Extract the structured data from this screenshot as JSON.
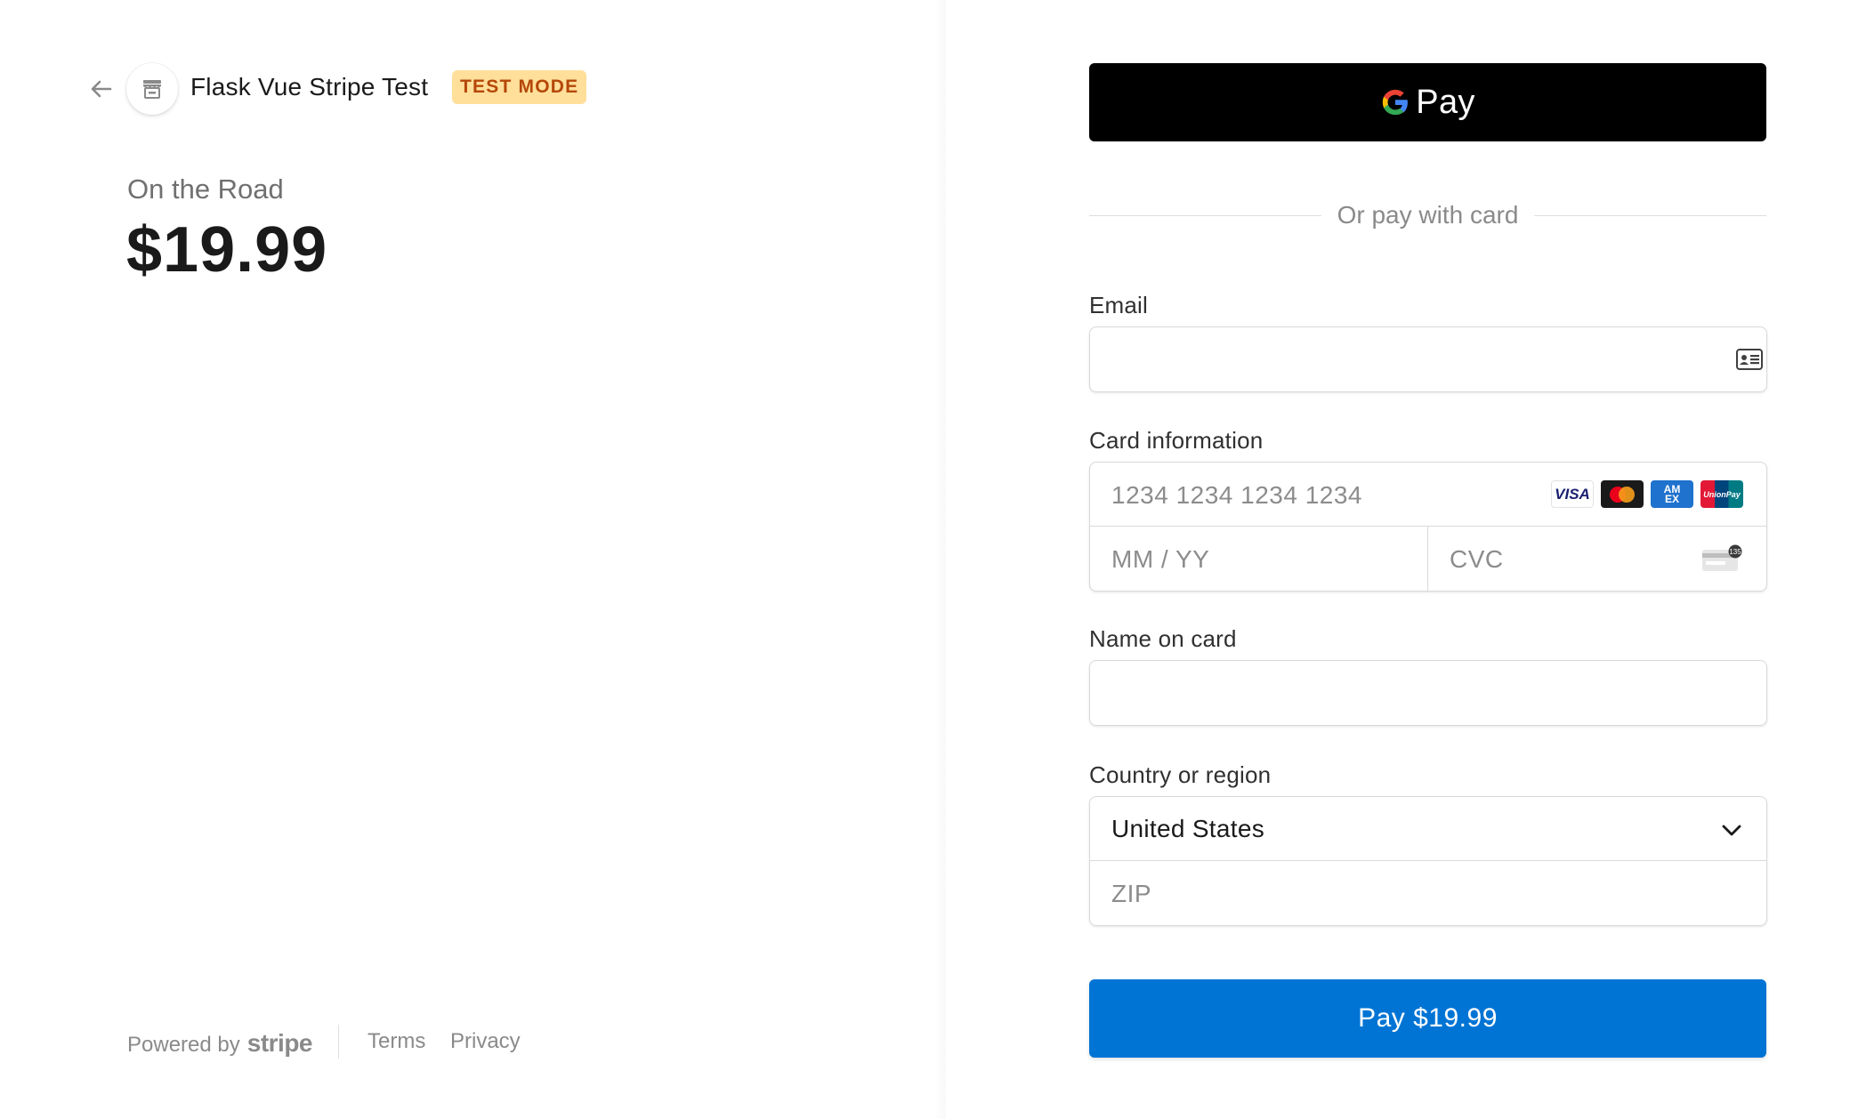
{
  "header": {
    "merchant_name": "Flask Vue Stripe Test",
    "mode_badge": "TEST MODE",
    "back_icon": "arrow-left-icon",
    "store_icon": "storefront-icon"
  },
  "product": {
    "name": "On the Road",
    "price": "$19.99"
  },
  "footer": {
    "powered_by": "Powered by",
    "brand": "stripe",
    "terms": "Terms",
    "privacy": "Privacy"
  },
  "wallet": {
    "label": "Pay",
    "icon": "google-g-icon"
  },
  "divider": {
    "text": "Or pay with card"
  },
  "form": {
    "email": {
      "label": "Email",
      "value": "",
      "icon": "contact-card-icon"
    },
    "card": {
      "label": "Card information",
      "number_placeholder": "1234 1234 1234 1234",
      "expiry_placeholder": "MM / YY",
      "cvc_placeholder": "CVC",
      "brands": [
        "VISA",
        "Mastercard",
        "AMEX",
        "UnionPay"
      ],
      "cvc_icon_text": "135"
    },
    "name": {
      "label": "Name on card",
      "value": ""
    },
    "country": {
      "label": "Country or region",
      "selected": "United States",
      "zip_placeholder": "ZIP"
    }
  },
  "pay_button": {
    "label": "Pay $19.99"
  },
  "colors": {
    "accent": "#0074d4",
    "badge_bg": "#ffdf9a",
    "badge_text": "#b54708",
    "wallet_bg": "#000000"
  }
}
